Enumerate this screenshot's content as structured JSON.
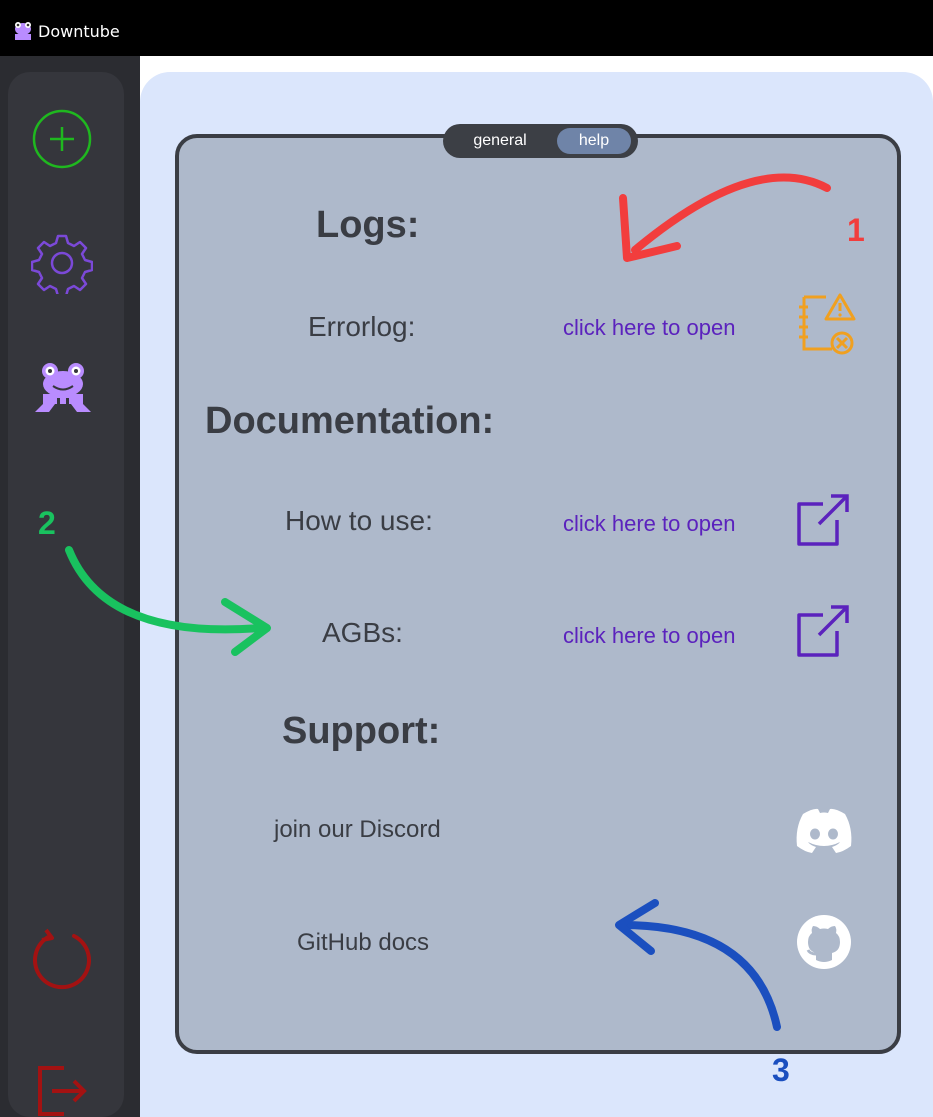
{
  "window": {
    "title": "Downtube"
  },
  "sidebar": {
    "items": [
      {
        "name": "add",
        "icon": "plus-circle-icon",
        "color": "#1fb81f"
      },
      {
        "name": "settings",
        "icon": "gear-icon",
        "color": "#7b49d8"
      },
      {
        "name": "help",
        "icon": "frog-icon",
        "color": "#b98cff"
      },
      {
        "name": "reload",
        "icon": "reload-icon",
        "color": "#a31212"
      },
      {
        "name": "exit",
        "icon": "logout-icon",
        "color": "#a31212"
      }
    ]
  },
  "tabs": {
    "general": "general",
    "help": "help",
    "active": "help"
  },
  "sections": {
    "logs": {
      "heading": "Logs:",
      "errorlog_label": "Errorlog:",
      "errorlog_link": "click here to open"
    },
    "documentation": {
      "heading": "Documentation:",
      "howto_label": "How to use:",
      "howto_link": "click here to open",
      "agbs_label": "AGBs:",
      "agbs_link": "click here to open"
    },
    "support": {
      "heading": "Support:",
      "discord_label": "join our Discord",
      "github_label": "GitHub docs"
    }
  },
  "annotations": {
    "one": "1",
    "two": "2",
    "three": "3"
  },
  "colors": {
    "accent_link": "#5b22bd",
    "arrow_red": "#f23d3d",
    "arrow_green": "#19c25f",
    "arrow_blue": "#1b4fbf"
  }
}
